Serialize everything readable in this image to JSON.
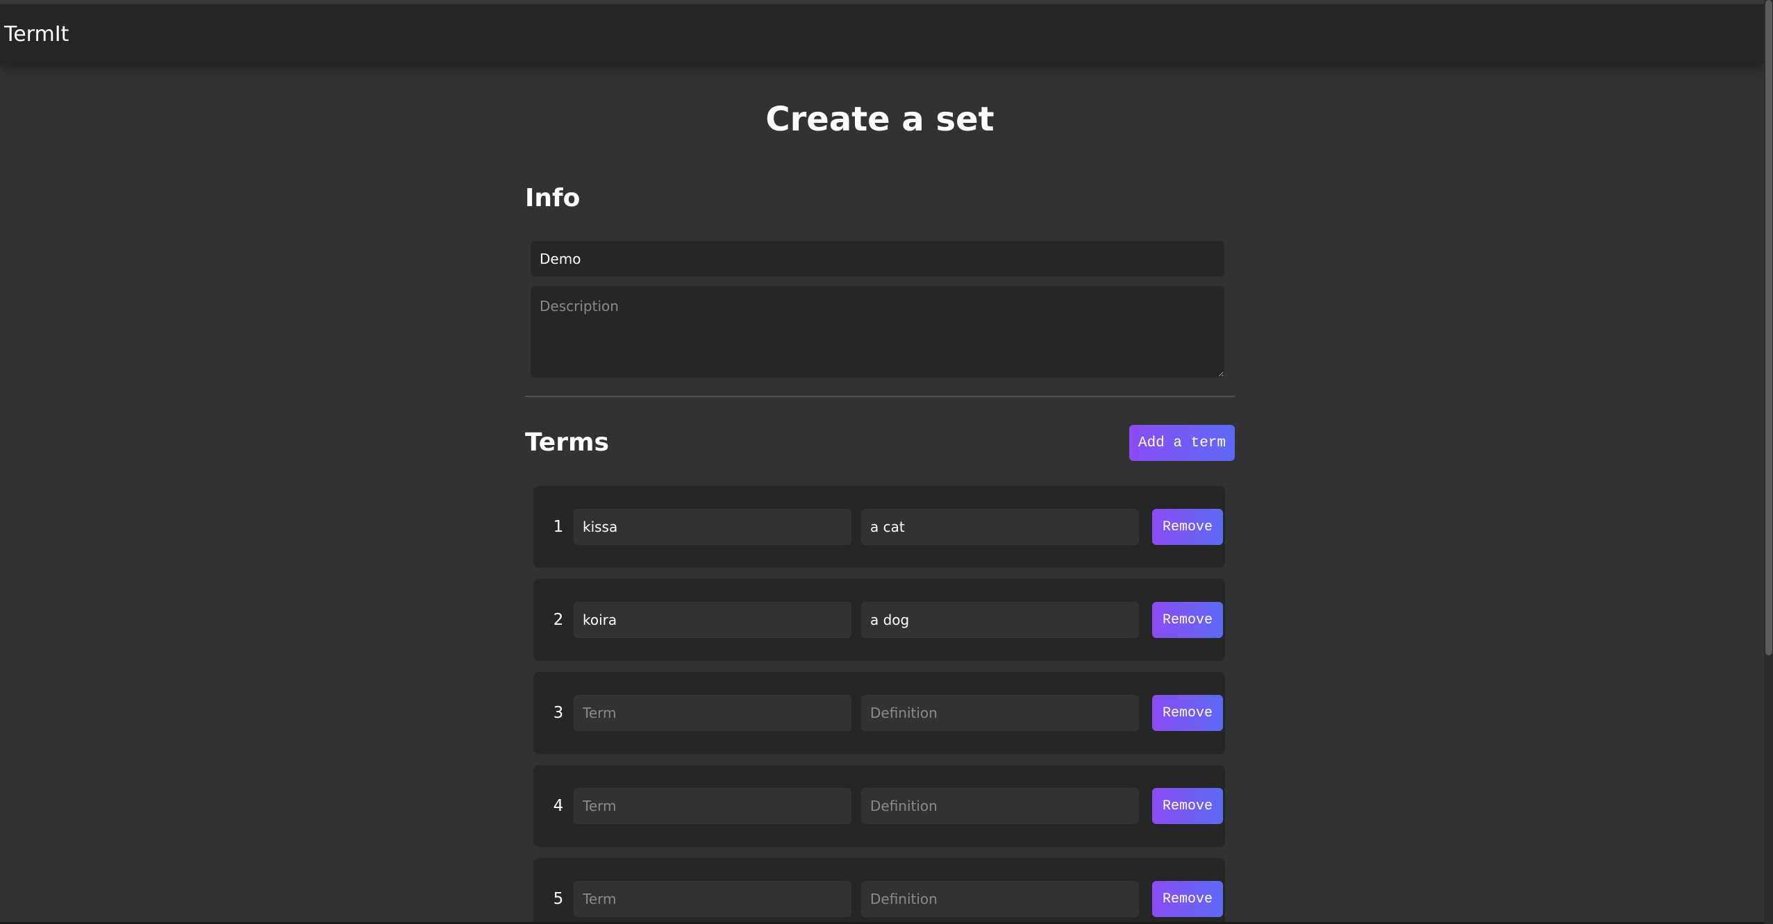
{
  "app": {
    "brand": "TermIt"
  },
  "page": {
    "title": "Create a set"
  },
  "info": {
    "heading": "Info",
    "title_value": "Demo",
    "title_placeholder": "",
    "description_value": "",
    "description_placeholder": "Description"
  },
  "terms": {
    "heading": "Terms",
    "add_button_label": "Add a term",
    "term_placeholder": "Term",
    "definition_placeholder": "Definition",
    "remove_label": "Remove",
    "items": [
      {
        "number": "1",
        "term": "kissa",
        "definition": "a cat"
      },
      {
        "number": "2",
        "term": "koira",
        "definition": "a dog"
      },
      {
        "number": "3",
        "term": "",
        "definition": ""
      },
      {
        "number": "4",
        "term": "",
        "definition": ""
      },
      {
        "number": "5",
        "term": "",
        "definition": ""
      }
    ]
  },
  "colors": {
    "background": "#323232",
    "navbar": "#262626",
    "accent_start": "#8b4cf3",
    "accent_end": "#5d6af7"
  }
}
